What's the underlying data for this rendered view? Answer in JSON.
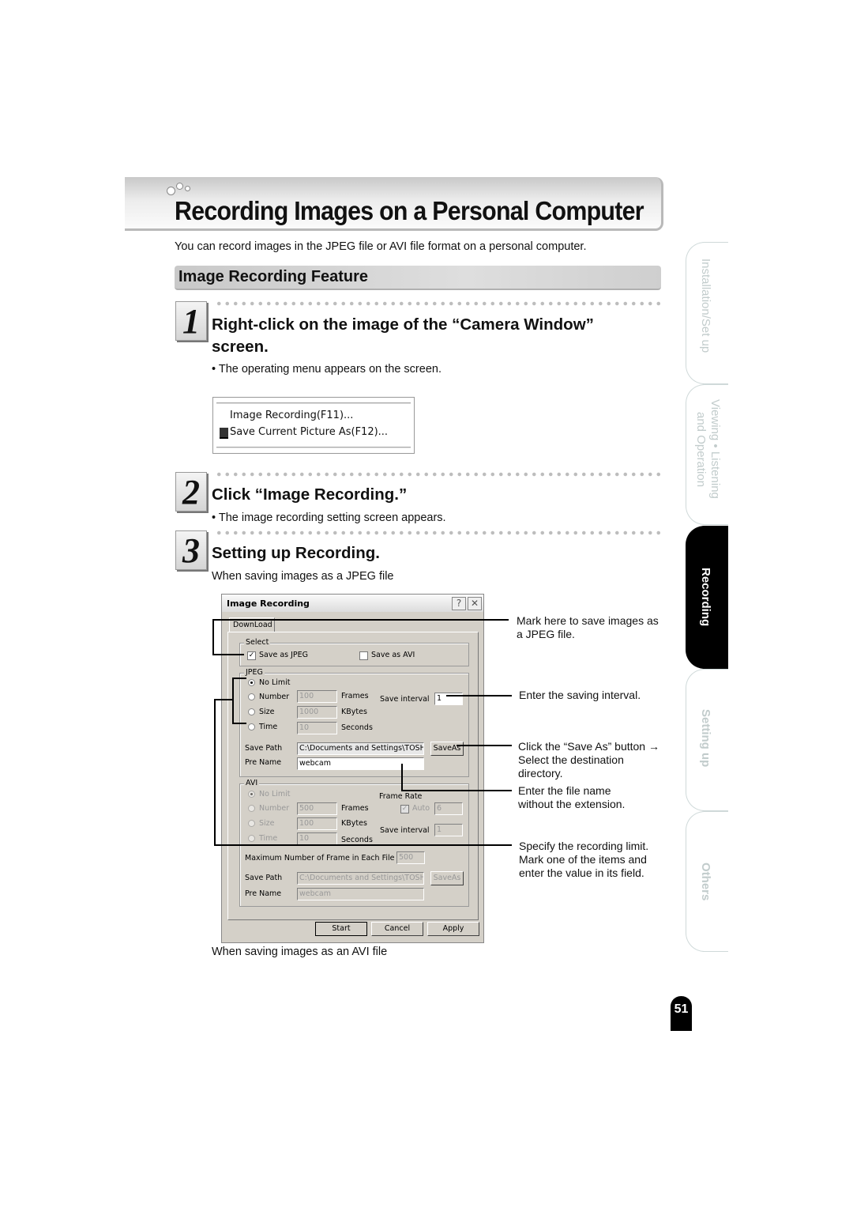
{
  "page": {
    "title": "Recording Images on a Personal Computer",
    "intro": "You can record images in the JPEG file or AVI file format on a personal computer.",
    "section_title": "Image Recording Feature",
    "page_number": "51"
  },
  "steps": [
    {
      "number": "1",
      "heading_line1": "Right-click on the image of the “Camera Window”",
      "heading_line2": "screen.",
      "note": "• The operating menu appears on the screen."
    },
    {
      "number": "2",
      "heading_line1": "Click “Image Recording.”",
      "note": "• The image recording setting screen appears."
    },
    {
      "number": "3",
      "heading_line1": "Setting up Recording.",
      "note": "When saving images as a JPEG file",
      "footer_note": "When saving images as an AVI file"
    }
  ],
  "context_menu": {
    "items": [
      "Image Recording(F11)...",
      "Save Current Picture As(F12)..."
    ],
    "icon": "save-picture-icon"
  },
  "dialog": {
    "title": "Image Recording",
    "help_label": "?",
    "close_label": "✕",
    "tab": "DownLoad",
    "select": {
      "label": "Select",
      "save_jpeg": "Save as JPEG",
      "save_jpeg_checked": true,
      "save_avi": "Save as AVI",
      "save_avi_checked": false
    },
    "jpeg": {
      "label": "JPEG",
      "options": [
        {
          "label": "No Limit",
          "selected": true,
          "value": "",
          "unit": ""
        },
        {
          "label": "Number",
          "selected": false,
          "value": "100",
          "unit": "Frames"
        },
        {
          "label": "Size",
          "selected": false,
          "value": "1000",
          "unit": "KBytes"
        },
        {
          "label": "Time",
          "selected": false,
          "value": "10",
          "unit": "Seconds"
        }
      ],
      "save_interval_label": "Save interval",
      "save_interval": "1",
      "save_path_label": "Save Path",
      "save_path": "C:\\Documents and Settings\\TOSHIB",
      "save_as_button": "SaveAs",
      "pre_name_label": "Pre Name",
      "pre_name": "webcam"
    },
    "avi": {
      "label": "AVI",
      "options": [
        {
          "label": "No Limit",
          "selected": true,
          "value": "",
          "unit": ""
        },
        {
          "label": "Number",
          "selected": false,
          "value": "500",
          "unit": "Frames"
        },
        {
          "label": "Size",
          "selected": false,
          "value": "100",
          "unit": "KBytes"
        },
        {
          "label": "Time",
          "selected": false,
          "value": "10",
          "unit": "Seconds"
        }
      ],
      "frame_rate_label": "Frame Rate",
      "auto_label": "Auto",
      "auto_checked": true,
      "frame_rate": "6",
      "save_interval_label": "Save interval",
      "save_interval": "1",
      "max_frames_label": "Maximum Number of Frame in Each File",
      "max_frames": "500",
      "save_path_label": "Save Path",
      "save_path": "C:\\Documents and Settings\\TOSHIB",
      "save_as_button": "SaveAs",
      "pre_name_label": "Pre Name",
      "pre_name": "webcam"
    },
    "buttons": {
      "start": "Start",
      "cancel": "Cancel",
      "apply": "Apply"
    }
  },
  "callouts": {
    "jpeg_check": "Mark here to save images as a JPEG file.",
    "interval": "Enter the saving interval.",
    "save_as": "Click the “Save As” button → Select the destination directory.",
    "file_name": "Enter the file name without the extension.",
    "limit": "Specify the recording limit. Mark one of the items and enter the value in its field."
  },
  "side_tabs": [
    {
      "label": "Installation/Set up",
      "active": false
    },
    {
      "label": "Viewing • Listening and Operation",
      "line1": "Viewing • Listening",
      "line2": "and Operation",
      "active": false
    },
    {
      "label": "Recording",
      "active": true
    },
    {
      "label": "Setting up",
      "active": false
    },
    {
      "label": "Others",
      "active": false
    }
  ]
}
